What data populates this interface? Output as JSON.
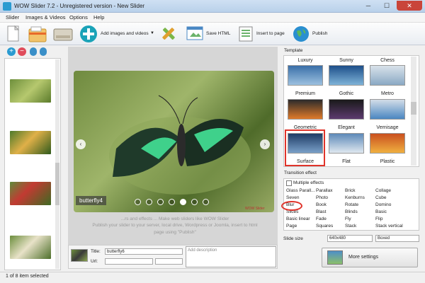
{
  "window": {
    "title": "WOW Slider 7.2 - Unregistered version - New Slider",
    "min": "─",
    "max": "☐",
    "close": "✕"
  },
  "menu": [
    "Slider",
    "Images & Videos",
    "Options",
    "Help"
  ],
  "toolbar": {
    "add_label": "Add images and videos",
    "save_html_label": "Save HTML",
    "insert_label": "Insert to page",
    "publish_label": "Publish"
  },
  "preview": {
    "caption": "butterfly4",
    "badge": "WOW Slider",
    "prev": "‹",
    "next": "›",
    "bullets_count": 7,
    "note_line1": "...rs and effects ... Make web sliders like WOW Slider",
    "note_line2": "Publish your slider to your server, local drive, Wordpress or Joomla, insert to html",
    "note_line3": "page using \"Publish\""
  },
  "edit": {
    "title_label": "Title:",
    "title_value": "butterfly6",
    "url_label": "Url:",
    "url_value": "",
    "description_placeholder": "Add description"
  },
  "template": {
    "heading": "Template",
    "items": [
      {
        "label": "Luxury"
      },
      {
        "label": "Sunny"
      },
      {
        "label": "Chess"
      },
      {
        "label": "Premium"
      },
      {
        "label": "Gothic"
      },
      {
        "label": "Metro"
      },
      {
        "label": "Geometric"
      },
      {
        "label": "Elegant"
      },
      {
        "label": "Vernisage"
      },
      {
        "label": "Surface"
      },
      {
        "label": "Flat"
      },
      {
        "label": "Plastic"
      }
    ],
    "selected": "Surface"
  },
  "transition": {
    "heading": "Transition effect",
    "multiple_label": "Multiple effects",
    "columns": [
      [
        "Glass Parall...",
        "Seven",
        "Blur",
        "Slices",
        "Basic linear",
        "Page"
      ],
      [
        "Parallax",
        "Photo",
        "Book",
        "Blast",
        "Fade",
        "Squares"
      ],
      [
        "Brick",
        "Kenburns",
        "Rotate",
        "Blinds",
        "Fly",
        "Stack"
      ],
      [
        "Collage",
        "Cube",
        "Domino",
        "Basic",
        "Flip",
        "Stack vertical"
      ]
    ],
    "selected": "Blur"
  },
  "slide_size": {
    "label": "Slide size",
    "value": "640x480",
    "mode": "Boxed"
  },
  "more_settings_label": "More settings",
  "status": "1 of 8 item selected",
  "colors": {
    "accent": "#e0342b",
    "toolbar_blue": "#2a9bd1"
  }
}
